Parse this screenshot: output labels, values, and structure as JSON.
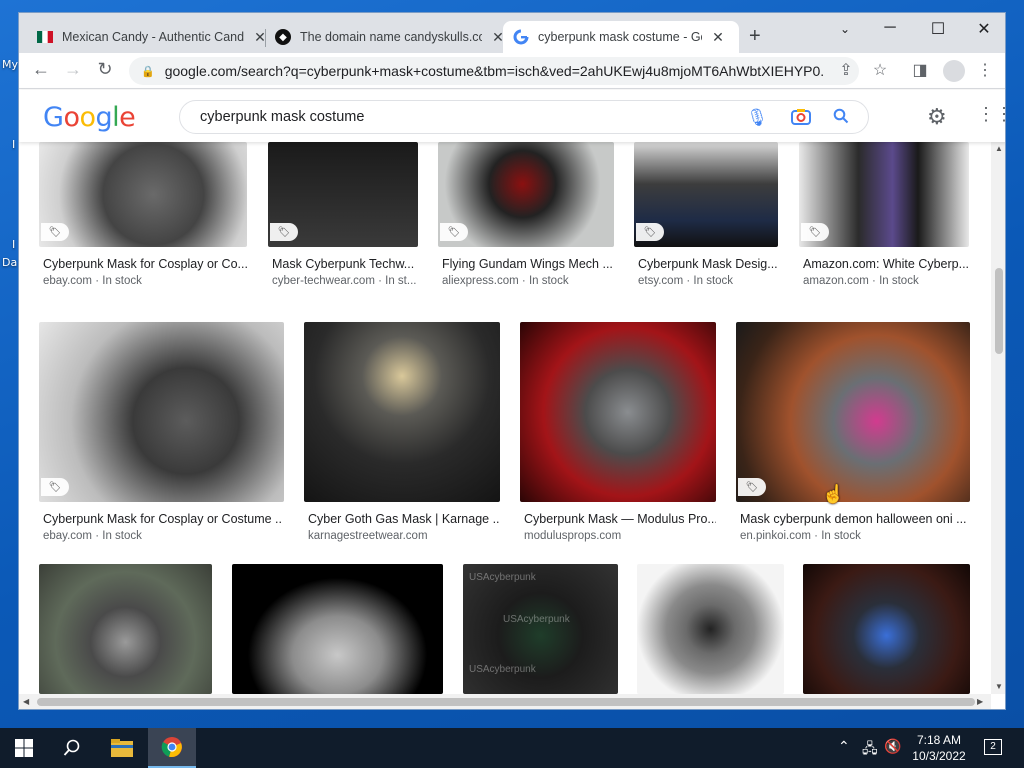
{
  "desktop": {
    "labels": [
      "My",
      "I",
      "I",
      "Da"
    ]
  },
  "tabs": [
    {
      "title": "Mexican Candy - Authentic Candy",
      "favicon": "mexico-flag-icon"
    },
    {
      "title": "The domain name candyskulls.com",
      "favicon": "domain-site-icon"
    },
    {
      "title": "cyberpunk mask costume - Google",
      "favicon": "google-g-icon"
    }
  ],
  "address_bar": {
    "url": "google.com/search?q=cyberpunk+mask+costume&tbm=isch&ved=2ahUKEwj4u8mjoMT6AhWbtXIEHYP0..."
  },
  "google": {
    "logo": "Google",
    "query": "cyberpunk mask costume"
  },
  "results": {
    "row1": [
      {
        "title": "Cyberpunk Mask for Cosplay or Co...",
        "source": "ebay.com",
        "stock": "In stock"
      },
      {
        "title": "Mask Cyberpunk Techw...",
        "source": "cyber-techwear.com",
        "stock": "In st..."
      },
      {
        "title": "Flying Gundam Wings Mech ...",
        "source": "aliexpress.com",
        "stock": "In stock"
      },
      {
        "title": "Cyberpunk Mask Desig...",
        "source": "etsy.com",
        "stock": "In stock"
      },
      {
        "title": "Amazon.com: White Cyberp...",
        "source": "amazon.com",
        "stock": "In stock"
      }
    ],
    "row2": [
      {
        "title": "Cyberpunk Mask for Cosplay or Costume ...",
        "source": "ebay.com",
        "stock": "In stock"
      },
      {
        "title": "Cyber Goth Gas Mask | Karnage ...",
        "source": "karnagestreetwear.com",
        "stock": ""
      },
      {
        "title": "Cyberpunk Mask — Modulus Pro...",
        "source": "modulusprops.com",
        "stock": ""
      },
      {
        "title": "Mask cyberpunk demon halloween oni ...",
        "source": "en.pinkoi.com",
        "stock": "In stock"
      }
    ],
    "row3_watermark": "USAcyberpunk"
  },
  "taskbar": {
    "time": "7:18 AM",
    "date": "10/3/2022",
    "notifications": "2"
  }
}
